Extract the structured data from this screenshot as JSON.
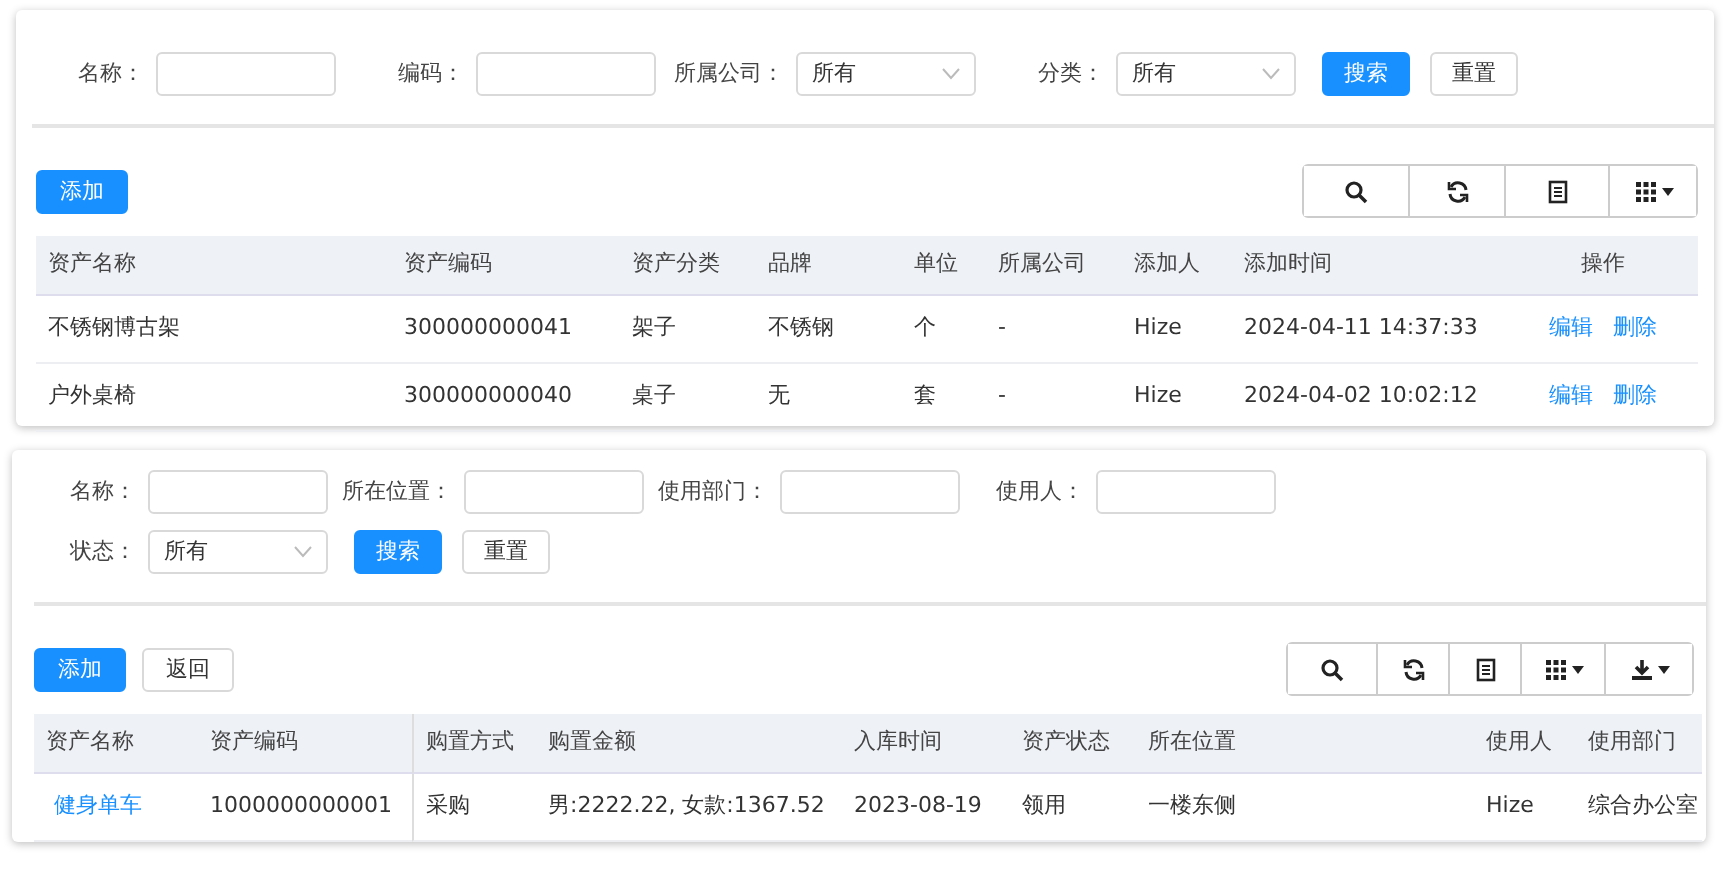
{
  "panels": [
    {
      "filter_rows": [
        [
          {
            "kind": "text",
            "label": "名称："
          },
          {
            "kind": "text",
            "label": "编码："
          },
          {
            "kind": "select",
            "label": "所属公司：",
            "value": "所有"
          },
          {
            "kind": "select",
            "label": "分类：",
            "value": "所有"
          },
          {
            "kind": "primary",
            "label": "搜索"
          },
          {
            "kind": "default",
            "label": "重置"
          }
        ]
      ],
      "actions": [
        {
          "kind": "primary",
          "label": "添加"
        }
      ],
      "tools": [
        {
          "kind": "search"
        },
        {
          "kind": "refresh"
        },
        {
          "kind": "document"
        },
        {
          "kind": "columns"
        }
      ],
      "columns": [
        {
          "label": "资产名称",
          "kind": "text"
        },
        {
          "label": "资产编码",
          "kind": "text"
        },
        {
          "label": "资产分类",
          "kind": "text"
        },
        {
          "label": "品牌",
          "kind": "text"
        },
        {
          "label": "单位",
          "kind": "text"
        },
        {
          "label": "所属公司",
          "kind": "text"
        },
        {
          "label": "添加人",
          "kind": "text"
        },
        {
          "label": "添加时间",
          "kind": "text"
        },
        {
          "label": "操作",
          "kind": "actions"
        }
      ],
      "rows": [
        {
          "cells": [
            "不锈钢博古架",
            "300000000041",
            "架子",
            "不锈钢",
            "个",
            "-",
            "Hize",
            "2024-04-11 14:37:33",
            [
              "编辑",
              "删除"
            ]
          ]
        },
        {
          "cells": [
            "户外桌椅",
            "300000000040",
            "桌子",
            "无",
            "套",
            "-",
            "Hize",
            "2024-04-02 10:02:12",
            [
              "编辑",
              "删除"
            ]
          ]
        }
      ]
    },
    {
      "filter_rows": [
        [
          {
            "kind": "text",
            "label": "名称："
          },
          {
            "kind": "text",
            "label": "所在位置："
          },
          {
            "kind": "text",
            "label": "使用部门："
          },
          {
            "kind": "text",
            "label": "使用人："
          }
        ],
        [
          {
            "kind": "select",
            "label": "状态：",
            "value": "所有"
          },
          {
            "kind": "primary",
            "label": "搜索"
          },
          {
            "kind": "default",
            "label": "重置"
          }
        ]
      ],
      "actions": [
        {
          "kind": "primary",
          "label": "添加"
        },
        {
          "kind": "default",
          "label": "返回"
        }
      ],
      "tools": [
        {
          "kind": "search"
        },
        {
          "kind": "refresh"
        },
        {
          "kind": "document"
        },
        {
          "kind": "columns"
        },
        {
          "kind": "download"
        }
      ],
      "columns": [
        {
          "label": "资产名称",
          "kind": "link"
        },
        {
          "label": "资产编码",
          "kind": "text"
        },
        {
          "label": "购置方式",
          "kind": "text"
        },
        {
          "label": "购置金额",
          "kind": "text"
        },
        {
          "label": "入库时间",
          "kind": "text"
        },
        {
          "label": "资产状态",
          "kind": "text"
        },
        {
          "label": "所在位置",
          "kind": "text"
        },
        {
          "label": "使用人",
          "kind": "text"
        },
        {
          "label": "使用部门",
          "kind": "text"
        }
      ],
      "rows": [
        {
          "cells": [
            "健身单车",
            "1000000000001",
            "采购",
            "男:2222.22, 女款:1367.52",
            "2023-08-19",
            "领用",
            "一楼东侧",
            "Hize",
            "综合办公室"
          ]
        }
      ]
    }
  ]
}
